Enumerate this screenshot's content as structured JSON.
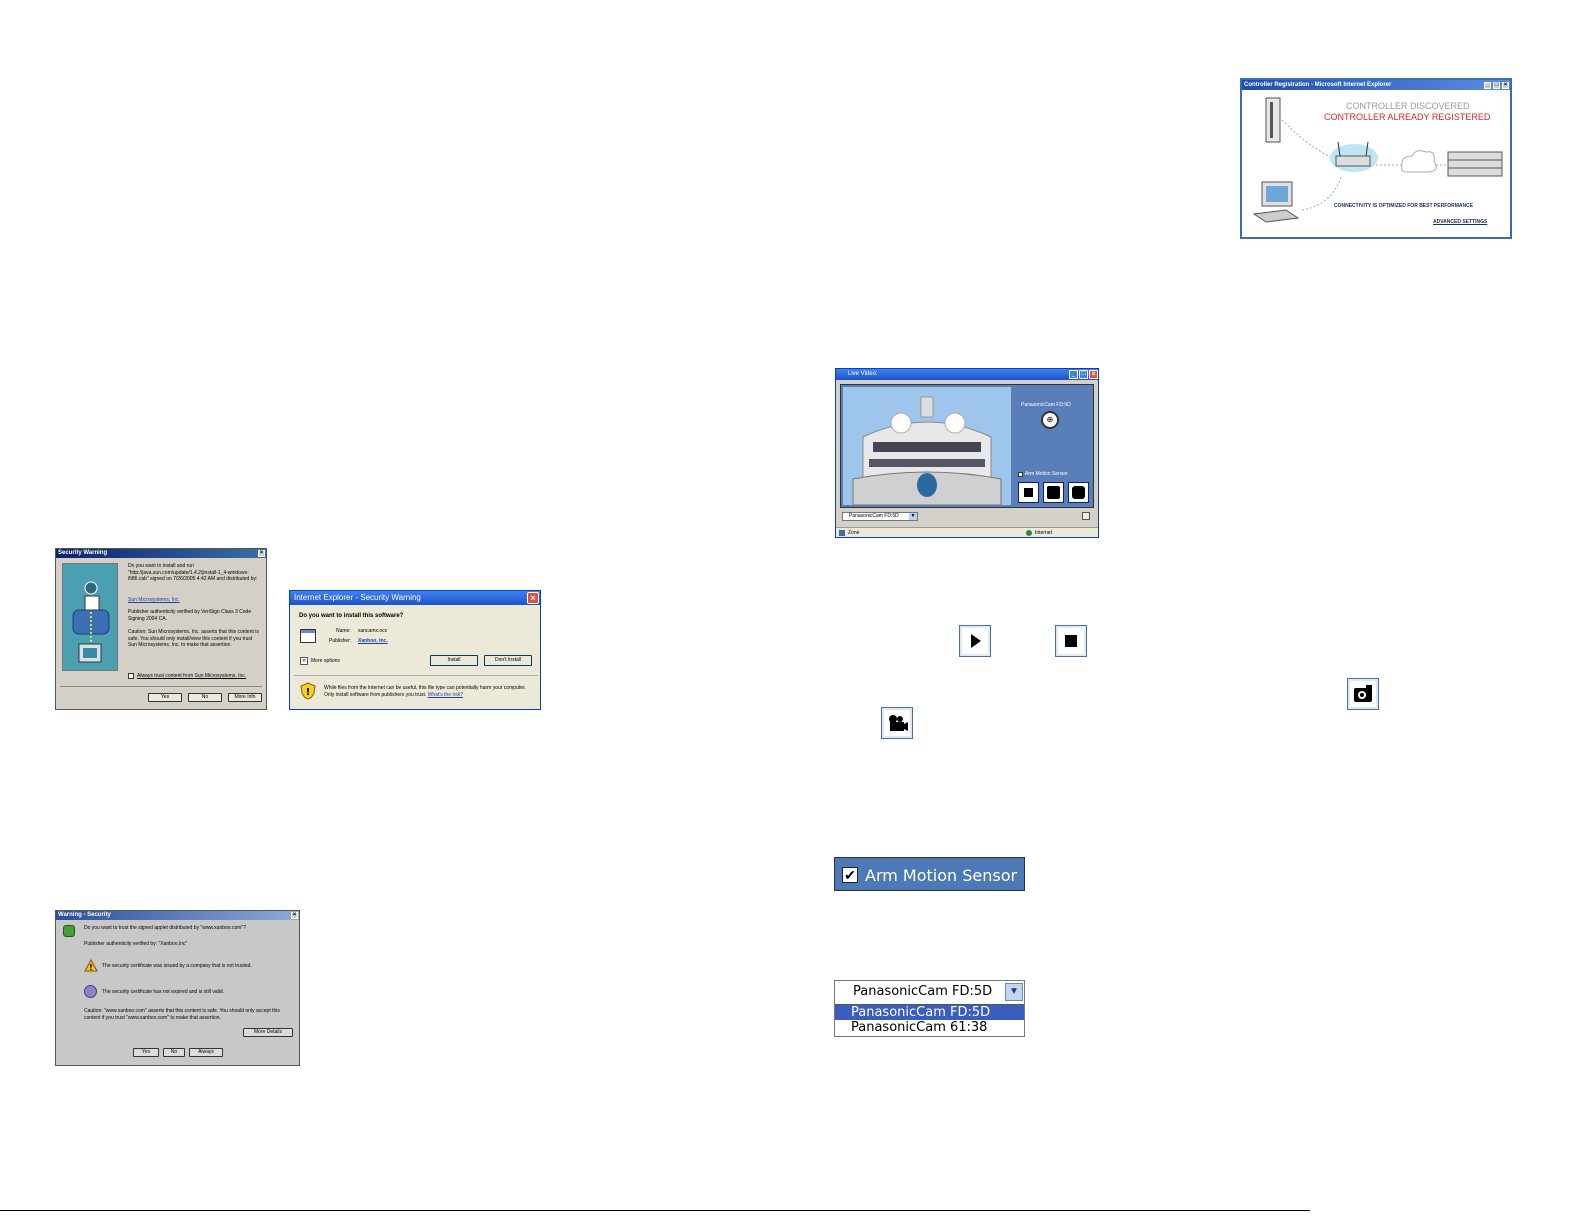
{
  "sun_dialog": {
    "title": "Security Warning",
    "question": "Do you want to install and run \"http://java.sun.com/update/1.4.2/jinstall-1_4-windows-i586.cab\" signed on 7/26/2005 4:42 AM and distributed by:",
    "publisher_link": "Sun Microsystems, Inc.",
    "authenticity": "Publisher authenticity verified by VeriSign Class 3 Code Signing 2004 CA.",
    "caution": "Caution: Sun Microsystems, Inc. asserts that this content is safe. You should only install/view this content if you trust Sun Microsystems, Inc. to make that assertion.",
    "always_trust": "Always trust content from Sun Microsystems, Inc.",
    "yes": "Yes",
    "no": "No",
    "more_info": "More Info"
  },
  "ie_dialog": {
    "title": "Internet Explorer - Security Warning",
    "question": "Do you want to install this software?",
    "name_label": "Name:",
    "name_value": "xancamx.ocx",
    "publisher_label": "Publisher:",
    "publisher_value": "Xanboo, Inc.",
    "more_options": "More options",
    "install": "Install",
    "dont_install": "Don't Install",
    "warning": "While files from the Internet can be useful, this file type can potentially harm your computer. Only install software from publishers you trust.",
    "whats_risk": "What's the risk?"
  },
  "java_dialog": {
    "title": "Warning - Security",
    "question": "Do you want to trust the signed applet distributed by \"www.xanboo.com\"?",
    "authenticity": "Publisher authenticity verified by: \"Xanboo,Inc\"",
    "untrusted": "The security certificate was issued by a company that is not trusted.",
    "valid": "The security certificate has not expired and is still valid.",
    "caution": "Caution: \"www.xanboo.com\" asserts that this content is safe. You should only accept this content if you trust \"www.xanboo.com\" to make that assertion.",
    "more_details": "More Details",
    "yes": "Yes",
    "no": "No",
    "always": "Always"
  },
  "controller_dialog": {
    "title": "Controller Registration - Microsoft Internet Explorer",
    "discovered": "CONTROLLER DISCOVERED",
    "registered": "CONTROLLER ALREADY REGISTERED",
    "connectivity": "CONNECTIVITY IS OPTIMIZED FOR BEST PERFORMANCE",
    "advanced": "ADVANCED SETTINGS"
  },
  "live_video": {
    "title": "Live Video:",
    "camera_name": "PanasonicCam FD:5D",
    "arm_motion": "Arm Motion Sensor",
    "select_value": "PanasonicCam FD:5D",
    "status_zone": "Zone",
    "status_internet": "Internet"
  },
  "arm_motion_large": {
    "label": "Arm Motion Sensor"
  },
  "camera_dropdown": {
    "selected": "PanasonicCam FD:5D",
    "options": [
      "PanasonicCam FD:5D",
      "PanasonicCam 61:38"
    ]
  },
  "colors": {
    "xp_blue": "#2a5fd8",
    "panel_blue": "#4d79b6",
    "registered_red": "#d9262e"
  }
}
